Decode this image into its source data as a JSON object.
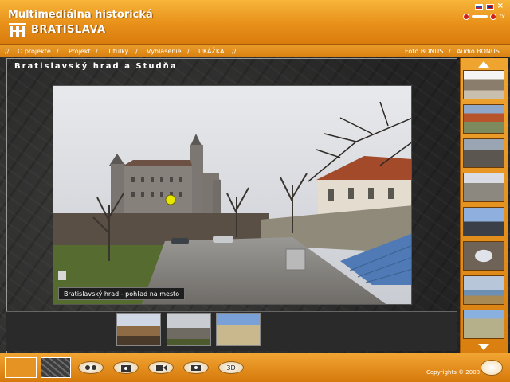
{
  "header": {
    "title": "Multimediálna historická",
    "city": "BRATISLAVA",
    "close": "×",
    "fx": "fx"
  },
  "nav": {
    "items": [
      "O projekte",
      "Projekt",
      "Titulky",
      "Vyhlásenie",
      "UKÁŽKA"
    ],
    "right_items": [
      "Foto BONUS",
      "Audio BONUS"
    ],
    "separator": "//",
    "slash": "/"
  },
  "photo": {
    "title": "Bratislavský hrad a Studňa",
    "caption": "Bratislavský hrad - pohľad na mesto"
  },
  "bottom": {
    "copyright": "Copyrights © 2008",
    "tool_3d": "3D"
  },
  "colors": {
    "accent": "#e8901a",
    "hotspot": "#e6e600"
  },
  "icons": [
    "logo-icon",
    "flag-sk-icon",
    "flag-en-icon",
    "close-icon",
    "mute-icon",
    "arrow-up-icon",
    "arrow-down-icon",
    "binoculars-icon",
    "camera-icon",
    "video-camera-icon",
    "3d-glasses-icon",
    "signpost-icon"
  ]
}
